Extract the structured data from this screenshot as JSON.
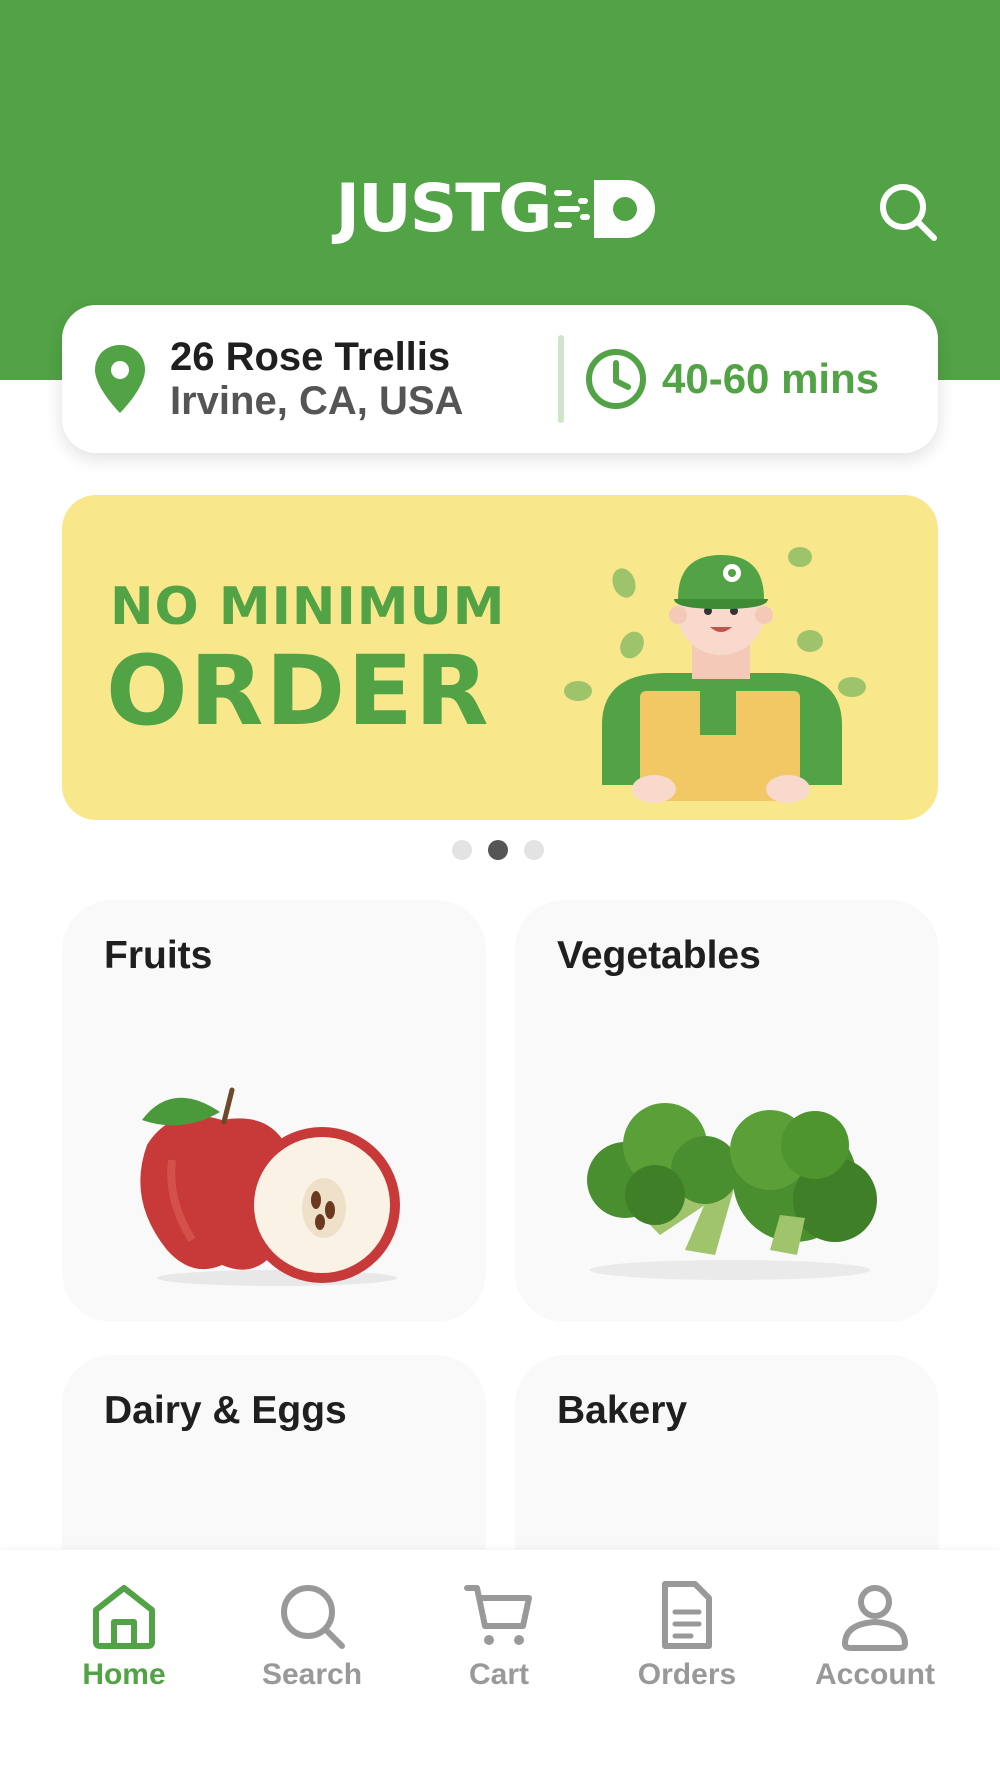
{
  "header": {
    "logo_text": "JUSTG",
    "logo_mark_icon": "delivery-o-icon",
    "search_icon": "search-icon",
    "brand_color": "#52a246"
  },
  "location": {
    "address_line1": "26 Rose Trellis",
    "address_line2": "Irvine, CA, USA",
    "pin_icon": "location-pin-icon",
    "clock_icon": "clock-icon",
    "eta": "40-60 mins"
  },
  "banner": {
    "line1": "NO MINIMUM",
    "line2": "ORDER",
    "background": "#f8e78b",
    "slides_total": 3,
    "active_slide": 2
  },
  "categories": [
    {
      "label": "Fruits",
      "image": "apple-image"
    },
    {
      "label": "Vegetables",
      "image": "broccoli-image"
    },
    {
      "label": "Dairy & Eggs",
      "image": "milk-jug-image"
    },
    {
      "label": "Bakery",
      "image": "bread-image"
    }
  ],
  "tabbar": {
    "items": [
      {
        "label": "Home",
        "icon": "home-icon",
        "active": true
      },
      {
        "label": "Search",
        "icon": "search-icon",
        "active": false
      },
      {
        "label": "Cart",
        "icon": "cart-icon",
        "active": false
      },
      {
        "label": "Orders",
        "icon": "orders-icon",
        "active": false
      },
      {
        "label": "Account",
        "icon": "account-icon",
        "active": false
      }
    ]
  }
}
